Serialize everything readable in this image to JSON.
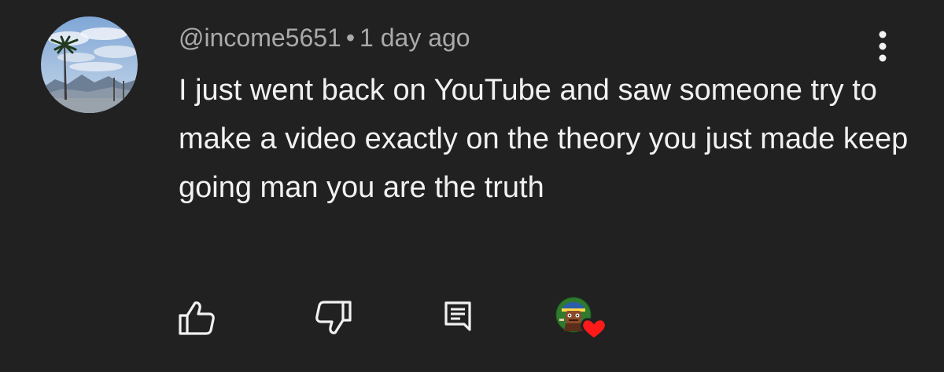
{
  "comment": {
    "author": "@income5651",
    "separator": "•",
    "timestamp": "1 day ago",
    "text": "I just went back on YouTube and saw someone try to make a video exactly on the theory you just made keep going man you are the truth"
  },
  "icons": {
    "avatar": "palm-tree-landscape-avatar",
    "menu": "more-vertical-icon",
    "like": "thumbs-up-icon",
    "dislike": "thumbs-down-icon",
    "reply": "comment-icon",
    "creator_heart": "creator-heart-icon"
  },
  "colors": {
    "background": "#212121",
    "meta_text": "#aaaaaa",
    "body_text": "#f1f1f1",
    "icon": "#f1f1f1",
    "heart": "#ff1a1a"
  }
}
